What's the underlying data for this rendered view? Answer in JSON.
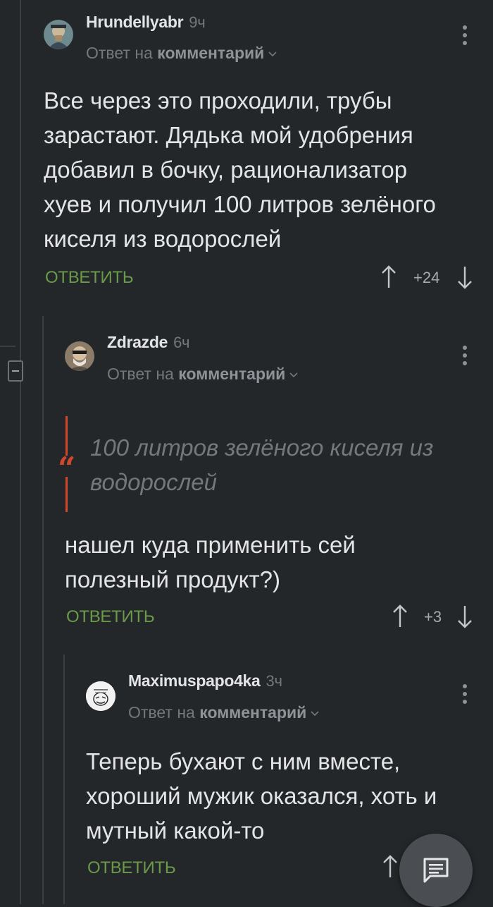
{
  "comments": [
    {
      "username": "Hrundellyabr",
      "time": "9ч",
      "reply_prefix": "Ответ на",
      "reply_target": "комментарий",
      "text_lines": [
        "Все через это проходили, трубы",
        "зарастают. Дядька мой удобрения",
        "добавил в бочку, рационализатор",
        "хуев и получил 100 литров зелёного",
        "киселя из водорослей"
      ],
      "reply_label": "ОТВЕТИТЬ",
      "rating": "+24",
      "avatar_icon": "user-avatar-portrait"
    },
    {
      "username": "Zdrazde",
      "time": "6ч",
      "reply_prefix": "Ответ на",
      "reply_target": "комментарий",
      "quote_lines": [
        "100 литров зелёного киселя из",
        "водорослей"
      ],
      "text_lines": [
        "нашел куда применить сей",
        "полезный продукт?)"
      ],
      "reply_label": "ОТВЕТИТЬ",
      "rating": "+3",
      "avatar_icon": "user-avatar-portrait"
    },
    {
      "username": "Maximuspapo4ka",
      "time": "3ч",
      "reply_prefix": "Ответ на",
      "reply_target": "комментарий",
      "text_lines": [
        "Теперь бухают с ним вместе,",
        "хороший мужик оказался, хоть и",
        "мутный какой-то"
      ],
      "reply_label": "ОТВЕТИТЬ",
      "avatar_icon": "user-avatar-sketch"
    }
  ],
  "colors": {
    "background": "#24272a",
    "accent_green": "#6a9a4a",
    "quote_red": "#d1472c"
  },
  "fab": {
    "icon": "comment-icon"
  }
}
